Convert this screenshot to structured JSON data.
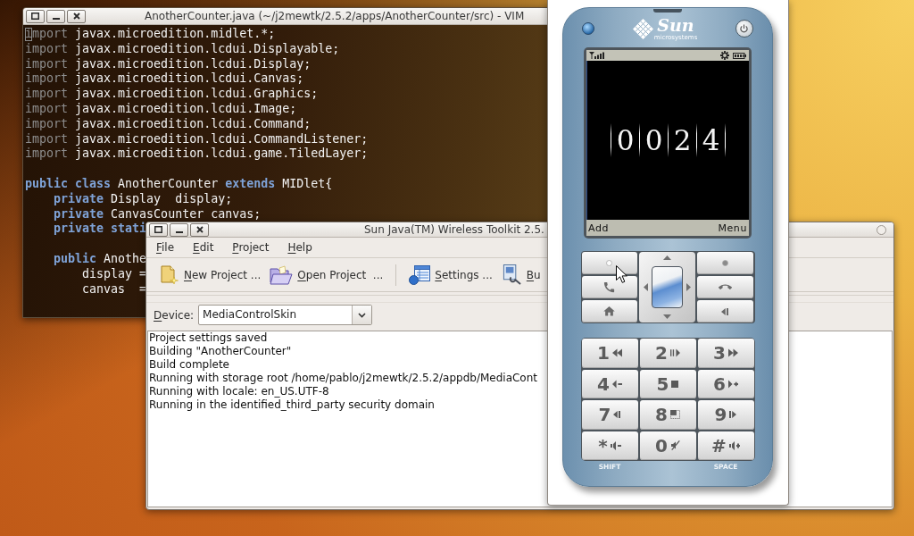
{
  "vim_window": {
    "title": "AnotherCounter.java (~/j2mewtk/2.5.2/apps/AnotherCounter/src) - VIM",
    "lines": [
      {
        "cursor": true,
        "segments": [
          {
            "kind": "preproc",
            "text": "import"
          },
          {
            "kind": "plain",
            "text": " javax.microedition.midlet.*;"
          }
        ]
      },
      {
        "cursor": false,
        "segments": [
          {
            "kind": "preproc",
            "text": "import"
          },
          {
            "kind": "plain",
            "text": " javax.microedition.lcdui.Displayable;"
          }
        ]
      },
      {
        "cursor": false,
        "segments": [
          {
            "kind": "preproc",
            "text": "import"
          },
          {
            "kind": "plain",
            "text": " javax.microedition.lcdui.Display;"
          }
        ]
      },
      {
        "cursor": false,
        "segments": [
          {
            "kind": "preproc",
            "text": "import"
          },
          {
            "kind": "plain",
            "text": " javax.microedition.lcdui.Canvas;"
          }
        ]
      },
      {
        "cursor": false,
        "segments": [
          {
            "kind": "preproc",
            "text": "import"
          },
          {
            "kind": "plain",
            "text": " javax.microedition.lcdui.Graphics;"
          }
        ]
      },
      {
        "cursor": false,
        "segments": [
          {
            "kind": "preproc",
            "text": "import"
          },
          {
            "kind": "plain",
            "text": " javax.microedition.lcdui.Image;"
          }
        ]
      },
      {
        "cursor": false,
        "segments": [
          {
            "kind": "preproc",
            "text": "import"
          },
          {
            "kind": "plain",
            "text": " javax.microedition.lcdui.Command;"
          }
        ]
      },
      {
        "cursor": false,
        "segments": [
          {
            "kind": "preproc",
            "text": "import"
          },
          {
            "kind": "plain",
            "text": " javax.microedition.lcdui.CommandListener;"
          }
        ]
      },
      {
        "cursor": false,
        "segments": [
          {
            "kind": "preproc",
            "text": "import"
          },
          {
            "kind": "plain",
            "text": " javax.microedition.lcdui.game.TiledLayer;"
          }
        ]
      },
      {
        "cursor": false
      },
      {
        "cursor": false,
        "segments": [
          {
            "kind": "keyword",
            "text": "public class"
          },
          {
            "kind": "plain",
            "text": " AnotherCounter "
          },
          {
            "kind": "keyword",
            "text": "extends"
          },
          {
            "kind": "plain",
            "text": " MIDlet{"
          }
        ]
      },
      {
        "cursor": false,
        "segments": [
          {
            "kind": "keyword",
            "text": "    private"
          },
          {
            "kind": "plain",
            "text": " Display  display;"
          }
        ]
      },
      {
        "cursor": false,
        "segments": [
          {
            "kind": "keyword",
            "text": "    private"
          },
          {
            "kind": "plain",
            "text": " CanvasCounter canvas;"
          }
        ]
      },
      {
        "cursor": false,
        "segments": [
          {
            "kind": "keyword",
            "text": "    private stati"
          }
        ]
      },
      {
        "cursor": false
      },
      {
        "cursor": false,
        "segments": [
          {
            "kind": "keyword",
            "text": "    public"
          },
          {
            "kind": "plain",
            "text": " Anothe"
          }
        ]
      },
      {
        "cursor": false,
        "segments": [
          {
            "kind": "plain",
            "text": "        display ="
          }
        ]
      },
      {
        "cursor": false,
        "segments": [
          {
            "kind": "plain",
            "text": "        canvas  ="
          }
        ]
      }
    ]
  },
  "toolkit_window": {
    "title": "Sun Java(TM) Wireless Toolkit 2.5.",
    "menu": [
      {
        "key": "F",
        "rest": "ile"
      },
      {
        "key": "E",
        "rest": "dit"
      },
      {
        "key": "P",
        "rest": "roject"
      },
      {
        "key": "H",
        "rest": "elp"
      }
    ],
    "toolbar": [
      {
        "kind": "new",
        "key": "N",
        "rest": "ew Project ..."
      },
      {
        "kind": "open",
        "key": "O",
        "rest": "pen Project  ..."
      },
      {
        "kind": "separator"
      },
      {
        "kind": "settings",
        "key": "S",
        "rest": "ettings ..."
      },
      {
        "kind": "build",
        "key": "B",
        "rest": "u"
      }
    ],
    "device": {
      "key": "D",
      "rest": "evice:",
      "value": "MediaControlSkin"
    },
    "log": [
      "Project settings saved",
      "Building \"AnotherCounter\"",
      "Build complete",
      "Running with storage root /home/pablo/j2mewtk/2.5.2/appdb/MediaCont",
      "Running with locale: en_US.UTF-8",
      "Running in the identified_third_party security domain"
    ]
  },
  "emulator": {
    "brand": "Sun",
    "brand_sub": "microsystems",
    "counter": [
      "0",
      "0",
      "2",
      "4"
    ],
    "soft_keys": [
      "Add",
      "Menu"
    ],
    "keys": [
      {
        "label": "1",
        "kind": "rewind"
      },
      {
        "label": "2",
        "kind": "play-pause"
      },
      {
        "label": "3",
        "kind": "fast-forward"
      },
      {
        "label": "4",
        "kind": "slower"
      },
      {
        "label": "5",
        "kind": "stop"
      },
      {
        "label": "6",
        "kind": "faster"
      },
      {
        "label": "7",
        "kind": "step-back"
      },
      {
        "label": "8",
        "kind": "frame"
      },
      {
        "label": "9",
        "kind": "step-forward"
      },
      {
        "label": "*",
        "kind": "volume-down",
        "caption": "SHIFT"
      },
      {
        "label": "0",
        "kind": "mute"
      },
      {
        "label": "#",
        "kind": "volume-up",
        "caption": "SPACE"
      }
    ]
  }
}
